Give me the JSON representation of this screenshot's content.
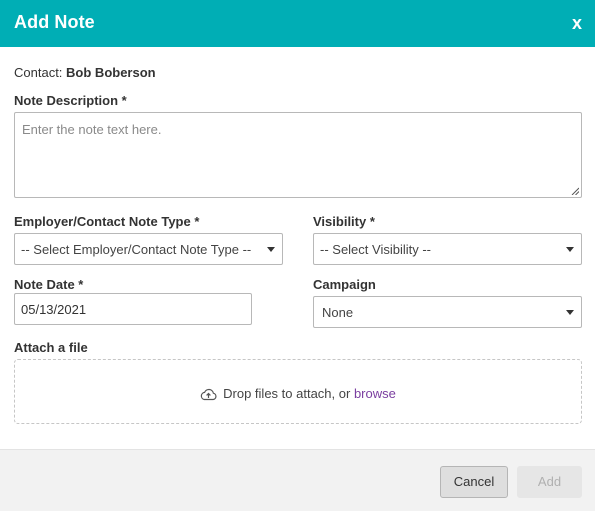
{
  "dialog": {
    "title": "Add Note",
    "close_label": "x"
  },
  "contact": {
    "label": "Contact:",
    "name": "Bob Boberson"
  },
  "note_description": {
    "label": "Note Description *",
    "placeholder": "Enter the note text here.",
    "value": ""
  },
  "note_type": {
    "label": "Employer/Contact Note Type *",
    "selected": "-- Select Employer/Contact Note Type --"
  },
  "visibility": {
    "label": "Visibility *",
    "selected": "-- Select Visibility --"
  },
  "note_date": {
    "label": "Note Date *",
    "value": "05/13/2021"
  },
  "campaign": {
    "label": "Campaign",
    "selected": "None"
  },
  "attachment": {
    "label": "Attach a file",
    "drop_text": "Drop files to attach, or",
    "browse_label": "browse",
    "icon": "cloud-upload-icon"
  },
  "footer": {
    "cancel_label": "Cancel",
    "add_label": "Add"
  },
  "colors": {
    "header_bg": "#00AEB5",
    "link": "#7b3fa0"
  }
}
